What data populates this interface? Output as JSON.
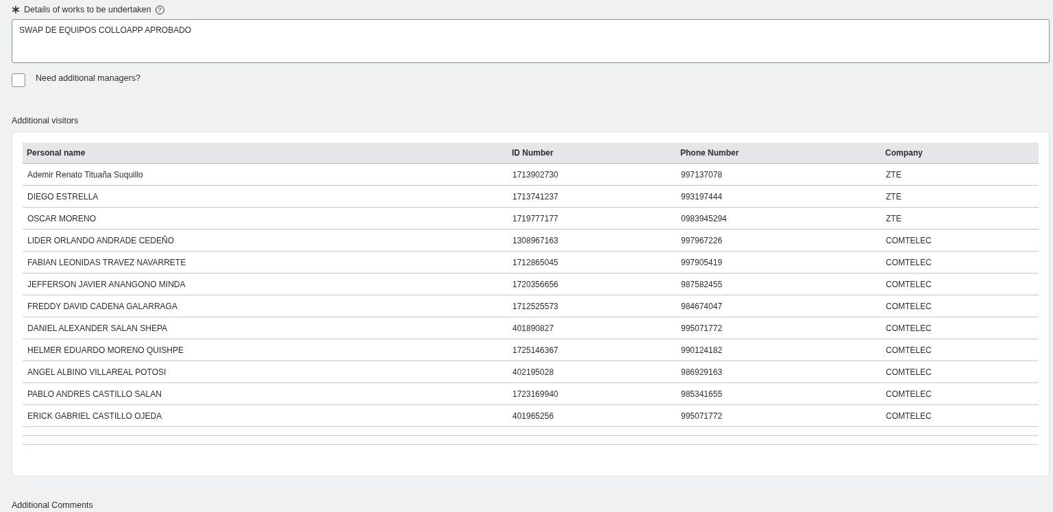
{
  "details": {
    "label": "Details of works to be undertaken",
    "required": true,
    "help_glyph": "?",
    "value": "SWAP DE EQUIPOS COLLOAPP APROBADO"
  },
  "need_managers": {
    "label": "Need additional managers?",
    "checked": false
  },
  "visitors": {
    "title": "Additional visitors",
    "columns": [
      "Personal name",
      "ID Number",
      "Phone Number",
      "Company"
    ],
    "rows": [
      [
        "Ademir Renato Tituaña Suquillo",
        "1713902730",
        "997137078",
        "ZTE"
      ],
      [
        "DIEGO ESTRELLA",
        "1713741237",
        "993197444",
        "ZTE"
      ],
      [
        "OSCAR MORENO",
        "1719777177",
        "0983945294",
        "ZTE"
      ],
      [
        "LIDER ORLANDO ANDRADE CEDEÑO",
        "1308967163",
        "997967226",
        "COMTELEC"
      ],
      [
        "FABIAN LEONIDAS TRAVEZ NAVARRETE",
        "1712865045",
        "997905419",
        "COMTELEC"
      ],
      [
        "JEFFERSON JAVIER ANANGONO MINDA",
        "1720356656",
        "987582455",
        "COMTELEC"
      ],
      [
        "FREDDY DAVID CADENA GALARRAGA",
        "1712525573",
        "984674047",
        "COMTELEC"
      ],
      [
        "DANIEL ALEXANDER SALAN SHEPA",
        "401890827",
        "995071772",
        "COMTELEC"
      ],
      [
        "HELMER EDUARDO MORENO QUISHPE",
        "1725146367",
        "990124182",
        "COMTELEC"
      ],
      [
        "ANGEL ALBINO VILLAREAL POTOSI",
        "402195028",
        "986929163",
        "COMTELEC"
      ],
      [
        "PABLO ANDRES CASTILLO SALAN",
        "1723169940",
        "985341655",
        "COMTELEC"
      ],
      [
        "ERICK GABRIEL CASTILLO OJEDA",
        "401965256",
        "995071772",
        "COMTELEC"
      ]
    ]
  },
  "comments": {
    "label": "Additional Comments"
  }
}
